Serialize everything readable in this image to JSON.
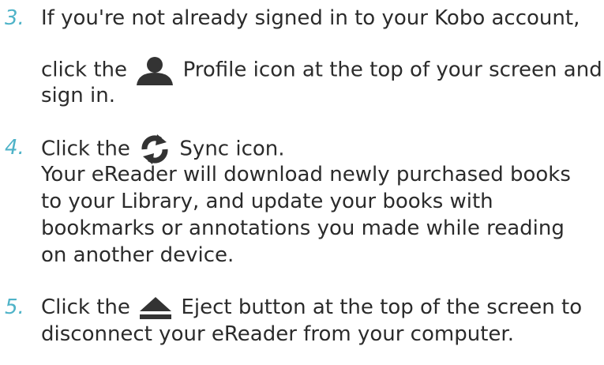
{
  "steps": [
    {
      "number": "3.",
      "lines": [
        "If you're not already signed in to your Kobo account,",
        "click the",
        "Profile icon at the top of your screen and",
        "sign in."
      ],
      "icon": "profile-icon"
    },
    {
      "number": "4.",
      "lines": [
        "Click the",
        "Sync icon.",
        "Your eReader will download newly purchased books",
        "to your Library, and update your books with",
        "bookmarks or annotations you made while reading",
        "on another device."
      ],
      "icon": "sync-icon"
    },
    {
      "number": "5.",
      "lines": [
        "Click the",
        "Eject button at the top of the screen to",
        "disconnect your eReader from your computer."
      ],
      "icon": "eject-icon"
    }
  ]
}
